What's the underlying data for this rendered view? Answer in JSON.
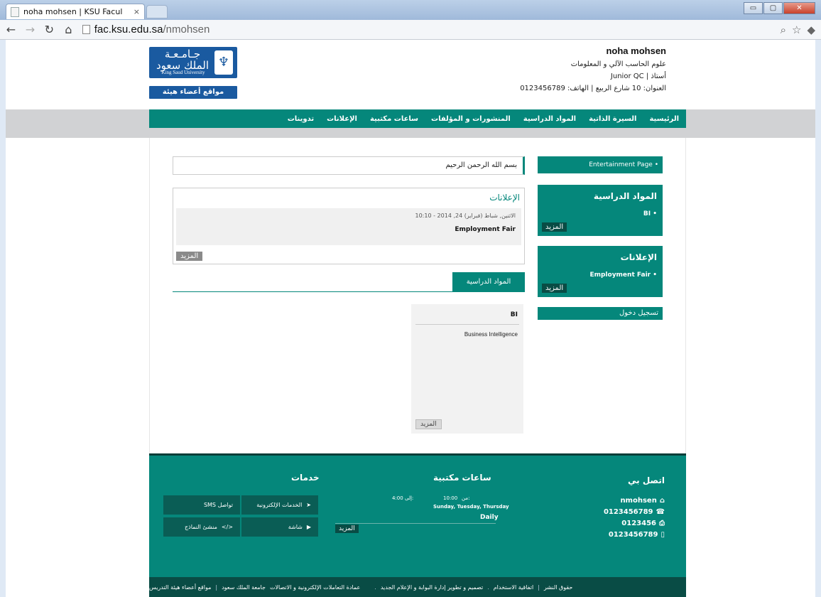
{
  "browser": {
    "tab_title": "noha mohsen | KSU Facul",
    "tab_close": "×",
    "url_host": "fac.ksu.edu.sa",
    "url_path": "/nmohsen",
    "win_min": "▭",
    "win_max": "▢",
    "win_close": "✕"
  },
  "header": {
    "logo_ar": "جـامـعـة الملك سعود",
    "logo_en": "King Saud University",
    "site_label": "مواقع أعضاء هيئة التدريس",
    "profile_name": "noha mohsen",
    "department": "علوم الحاسب الآلي و المعلومات",
    "position": "أستاذ | Junior QC",
    "address": "العنوان: 10 شارع الربيع | الهاتف: 0123456789"
  },
  "nav": {
    "items": [
      "الرئيسية",
      "السيرة الذاتية",
      "المواد الدراسية",
      "المنشورات و المؤلفات",
      "ساعات مكتبية",
      "الإعلانات",
      "تدوينات"
    ]
  },
  "sidebar": {
    "entertainment": "Entertainment Page",
    "courses_title": "المواد الدراسية",
    "courses_item": "BI",
    "courses_more": "المزيد",
    "ann_title": "الإعلانات",
    "ann_item": "Employment Fair",
    "ann_more": "المزيد",
    "login": "تسجيل دخول"
  },
  "main": {
    "basmala": "بسم الله الرحمن الرحيم",
    "ann_header": "الإعلانات",
    "ann_date": "الاثنين, شباط (فبراير) 24, 2014 - 10:10",
    "ann_title": "Employment Fair",
    "ann_more": "المزيد",
    "courses_tab": "المواد الدراسية",
    "course_code": "BI",
    "course_desc": "Business Intelligence",
    "course_more": "المزيد"
  },
  "footer": {
    "contact_title": "اتصل بي",
    "contact_user": "nmohsen",
    "contact_phone": "0123456789",
    "contact_fax": "0123456",
    "contact_mobile": "0123456789",
    "hours_title": "ساعات مكتبية",
    "hours_from_label": "من:",
    "hours_from": "10:00",
    "hours_to_label": "إلى:",
    "hours_to": "4:00",
    "hours_days": "Sunday, Tuesday, Thursday",
    "hours_freq": "Daily",
    "hours_more": "المزيد",
    "services_title": "خدمات",
    "svc_eservices": "الخدمات الإلكترونية",
    "svc_sms": "SMS تواصل",
    "svc_screen": "شاشة",
    "svc_forms": "منشئ النماذج"
  },
  "bottom": {
    "links": [
      "مواقع أعضاء هيئة التدريس",
      "جامعة الملك سعود",
      "عمادة التعاملات الإلكترونية و الاتصالات",
      "تصميم و تطوير إدارة البوابة و الإعلام الجديد",
      "اتفاقية الاستخدام",
      "حقوق النشر"
    ]
  }
}
